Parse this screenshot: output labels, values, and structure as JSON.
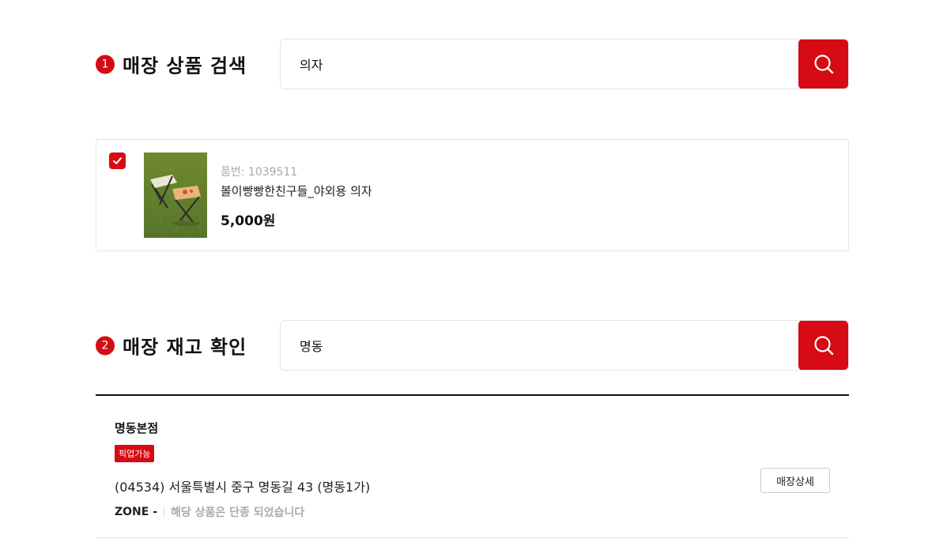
{
  "section1": {
    "step": "1",
    "title": "매장 상품 검색",
    "search_value": "의자"
  },
  "product": {
    "code": "품번: 1039511",
    "name": "볼이빵빵한친구들_야외용 의자",
    "price": "5,000원",
    "checked": true
  },
  "section2": {
    "step": "2",
    "title": "매장 재고 확인",
    "search_value": "명동"
  },
  "store": {
    "name": "명동본점",
    "badge": "픽업가능",
    "address": "(04534) 서울특별시 중구 명동길 43 (명동1가)",
    "zone_label": "ZONE -",
    "zone_note": "해당 상품은 단종 되었습니다",
    "detail_button": "매장상세"
  },
  "colors": {
    "accent": "#d60b14",
    "border": "#e5e5e5",
    "muted": "#aaaaaa"
  },
  "icons": {
    "search": "search-icon",
    "check": "check-icon"
  }
}
